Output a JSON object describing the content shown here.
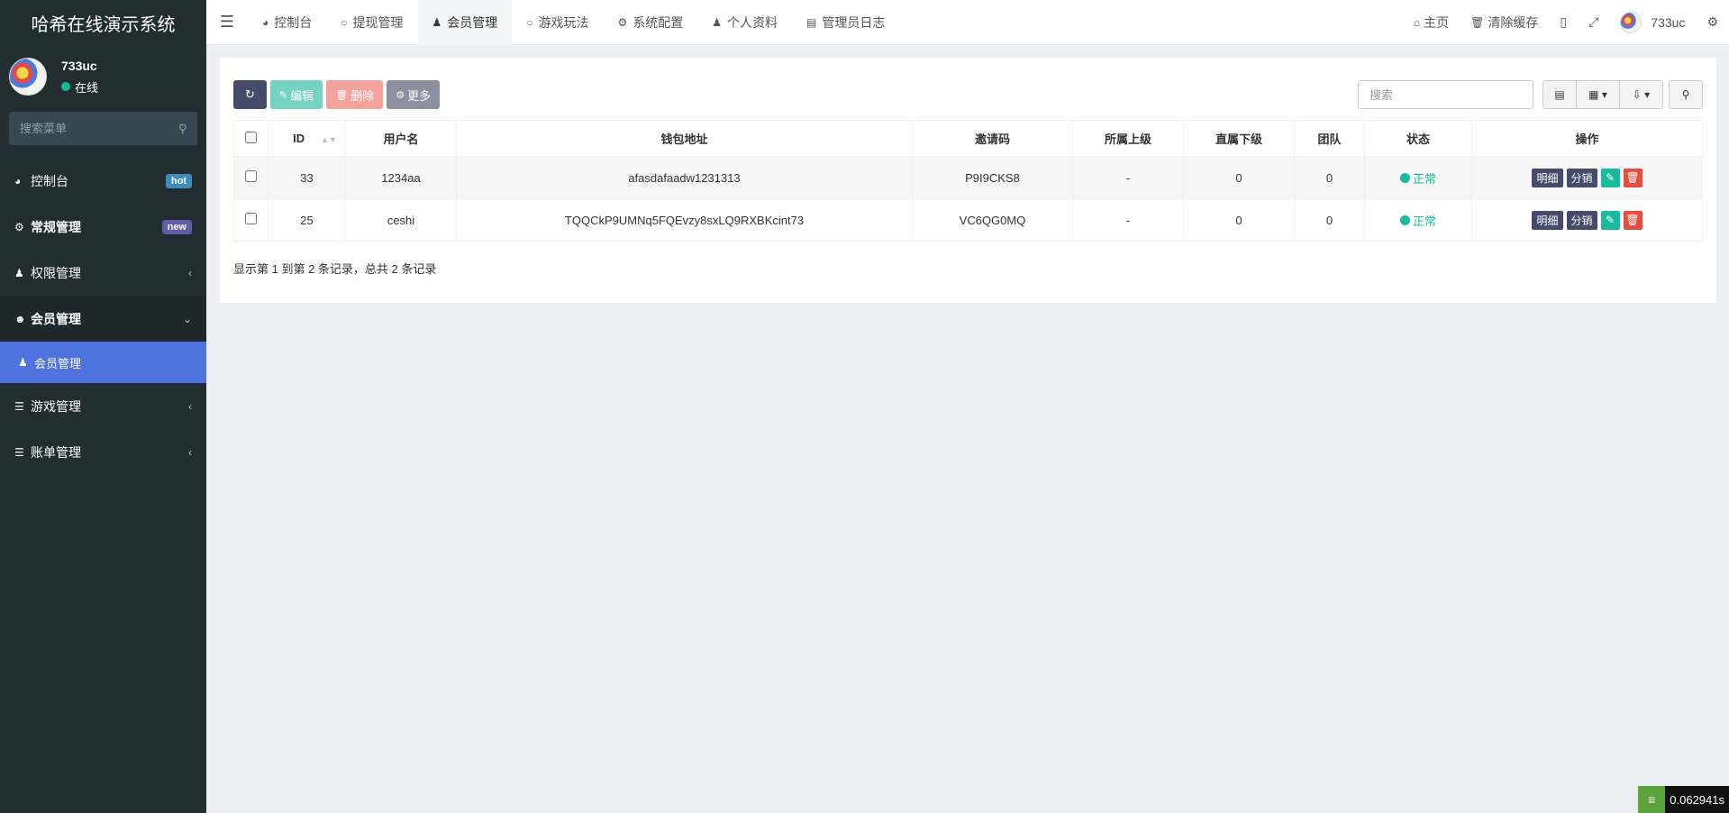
{
  "app": {
    "title": "哈希在线演示系统"
  },
  "user": {
    "name": "733uc",
    "status": "在线"
  },
  "sidebar": {
    "search_placeholder": "搜索菜单",
    "items": [
      {
        "label": "控制台",
        "badge": "hot",
        "icon": "dashboard-icon"
      },
      {
        "label": "常规管理",
        "badge": "new",
        "icon": "cogs-icon"
      },
      {
        "label": "权限管理",
        "icon": "group-icon"
      },
      {
        "label": "会员管理",
        "icon": "user-circle-icon"
      },
      {
        "label": "会员管理",
        "icon": "user-icon"
      },
      {
        "label": "游戏管理",
        "icon": "list-icon"
      },
      {
        "label": "账单管理",
        "icon": "list-icon"
      }
    ]
  },
  "topnav": {
    "tabs": [
      {
        "label": "控制台",
        "icon": "dashboard-icon"
      },
      {
        "label": "提现管理",
        "icon": "circle-icon"
      },
      {
        "label": "会员管理",
        "icon": "user-icon"
      },
      {
        "label": "游戏玩法",
        "icon": "circle-icon"
      },
      {
        "label": "系统配置",
        "icon": "gear-icon"
      },
      {
        "label": "个人资料",
        "icon": "user-icon"
      },
      {
        "label": "管理员日志",
        "icon": "list-alt-icon"
      }
    ],
    "right": {
      "home": "主页",
      "clear_cache": "清除缓存",
      "username": "733uc"
    }
  },
  "toolbar": {
    "edit_label": "编辑",
    "delete_label": "删除",
    "more_label": "更多",
    "search_placeholder": "搜索"
  },
  "table": {
    "headers": [
      "ID",
      "用户名",
      "钱包地址",
      "邀请码",
      "所属上级",
      "直属下级",
      "团队",
      "状态",
      "操作"
    ],
    "rows": [
      {
        "id": "33",
        "username": "1234aa",
        "wallet": "afasdafaadw1231313",
        "invite_code": "P9I9CKS8",
        "parent": "-",
        "direct": "0",
        "team": "0",
        "status": "正常"
      },
      {
        "id": "25",
        "username": "ceshi",
        "wallet": "TQQCkP9UMNq5FQEvzy8sxLQ9RXBKcint73",
        "invite_code": "VC6QG0MQ",
        "parent": "-",
        "direct": "0",
        "team": "0",
        "status": "正常"
      }
    ],
    "ops": {
      "detail": "明细",
      "dist": "分销"
    }
  },
  "summary": "显示第 1 到第 2 条记录，总共 2 条记录",
  "timer": "0.062941s",
  "colors": {
    "sidebar_bg": "#222d32",
    "active_menu": "#4e73df",
    "status_green": "#18bc9c",
    "danger": "#e74c3c"
  }
}
